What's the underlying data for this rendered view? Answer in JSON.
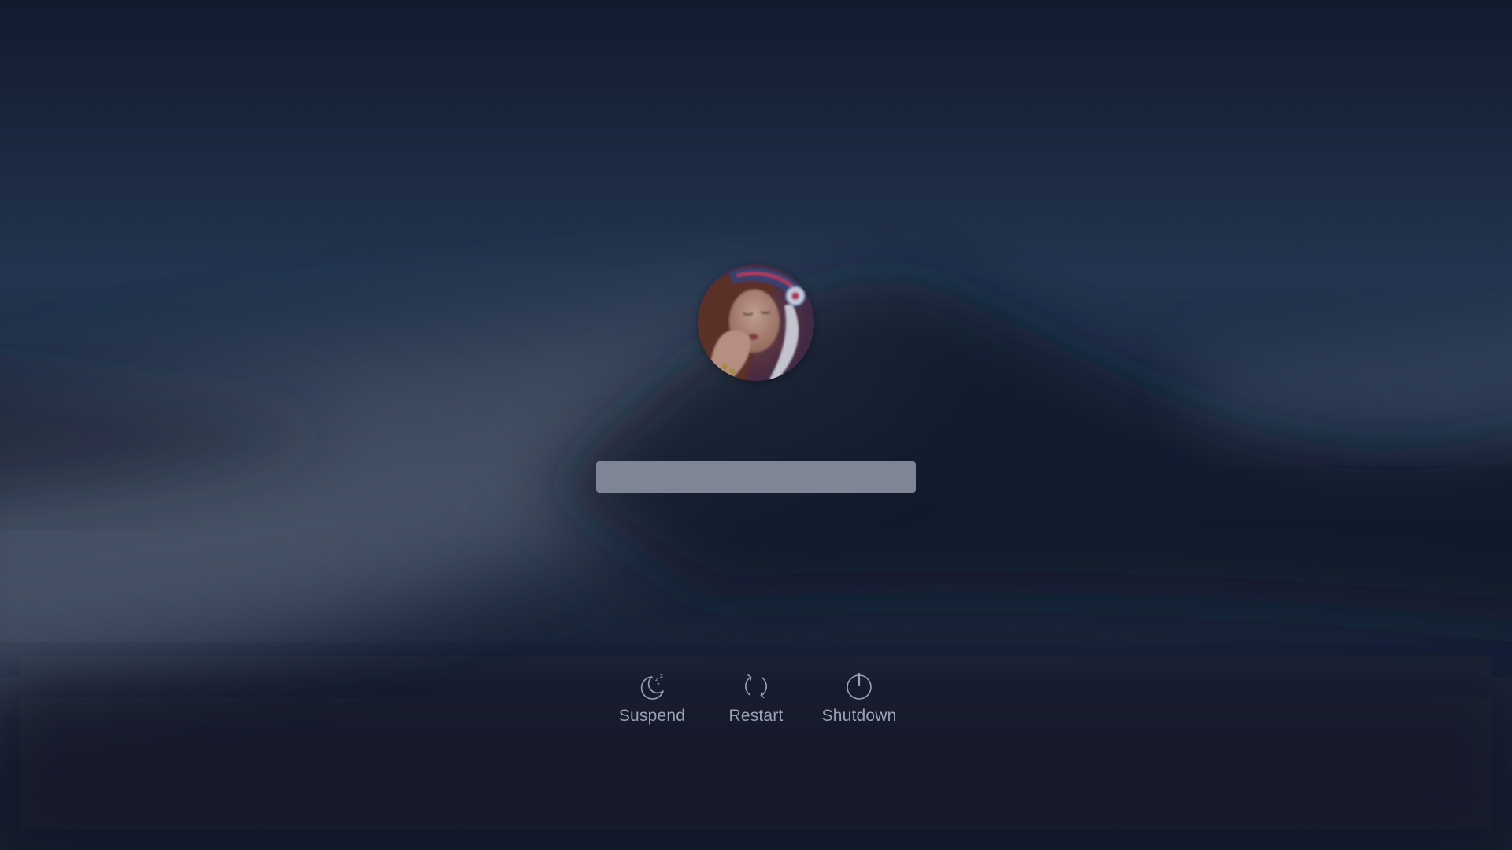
{
  "lockscreen": {
    "password": {
      "value": "",
      "placeholder": ""
    }
  },
  "actions": [
    {
      "label": "Suspend",
      "icon": "moon-sleep-icon"
    },
    {
      "label": "Restart",
      "icon": "restart-icon"
    },
    {
      "label": "Shutdown",
      "icon": "power-icon"
    }
  ],
  "colors": {
    "background": "#1a2438",
    "field": "#7e8594",
    "label": "#9aa2b3"
  }
}
